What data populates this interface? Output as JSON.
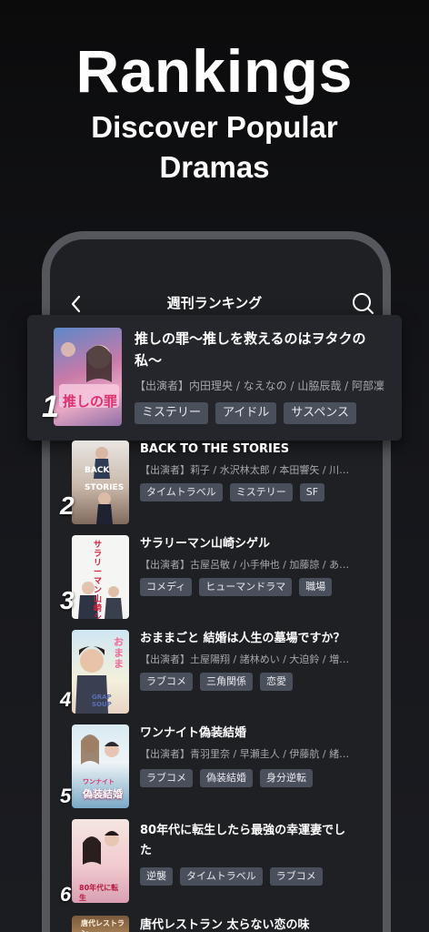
{
  "hero": {
    "title": "Rankings",
    "subtitle_line1": "Discover Popular",
    "subtitle_line2": "Dramas"
  },
  "nav": {
    "title": "週刊ランキング",
    "back_icon": "chevron-left-icon",
    "search_icon": "search-icon"
  },
  "items": [
    {
      "rank": "1",
      "title_line1": "推しの罪〜推しを救えるのはヲタクの",
      "title_line2": "私〜",
      "cast": "【出演者】内田理央 / なえなの / 山脇辰哉 / 阿部凜",
      "tags": [
        "ミステリー",
        "アイドル",
        "サスペンス"
      ]
    },
    {
      "rank": "2",
      "title_line1": "BACK TO THE STORIES",
      "title_line2": "",
      "cast": "【出演者】莉子 / 水沢林太郎 / 本田響矢 / 川口ゆ…",
      "tags": [
        "タイムトラベル",
        "ミステリー",
        "SF"
      ]
    },
    {
      "rank": "3",
      "title_line1": "サラリーマン山崎シゲル",
      "title_line2": "",
      "cast": "【出演者】古屋呂敏 / 小手伸也 / 加藤諒 / あぁ〜…",
      "tags": [
        "コメディ",
        "ヒューマンドラマ",
        "職場"
      ]
    },
    {
      "rank": "4",
      "title_line1": "おままごと 結婚は人生の墓場ですか？",
      "title_line2": "",
      "cast": "【出演者】土屋陽翔 / 諸林めい / 大迫鈴 / 増留優…",
      "tags": [
        "ラブコメ",
        "三角関係",
        "恋愛"
      ]
    },
    {
      "rank": "5",
      "title_line1": "ワンナイト偽装結婚",
      "title_line2": "",
      "cast": "【出演者】青羽里奈 / 早瀬圭人 / 伊藤航 / 緒方あ…",
      "tags": [
        "ラブコメ",
        "偽装結婚",
        "身分逆転"
      ]
    },
    {
      "rank": "6",
      "title_line1": "80年代に転生したら最強の幸運妻でし",
      "title_line2": "た",
      "cast": "",
      "tags": [
        "逆襲",
        "タイムトラベル",
        "ラブコメ"
      ]
    },
    {
      "rank": "",
      "title_line1": "唐代レストラン 太らない恋の味",
      "title_line2": "",
      "cast": "",
      "tags": []
    }
  ],
  "poster_art": {
    "p1_text": "推しの罪",
    "p2_line1": "BACK",
    "p2_line2": "STORIES",
    "p3_text": "サラリーマン山崎シゲル",
    "p4_text": "おまま",
    "p4_sub": "GRAP SOUP",
    "p5_text": "偽装結婚",
    "p5_sub": "ワンナイト",
    "p6_text": "80年代に転生",
    "p7_text": "唐代レストラン"
  },
  "colors": {
    "background": "#111214",
    "card": "#25262b",
    "tag_bg": "#4a4f5c",
    "cast_text": "#a5a7ad"
  }
}
